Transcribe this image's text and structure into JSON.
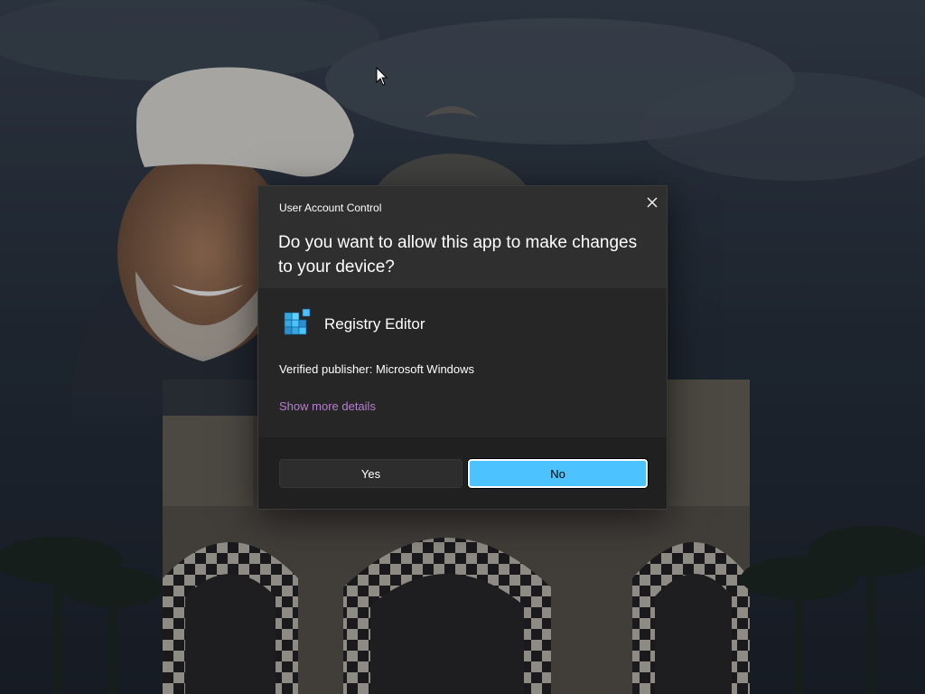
{
  "dialog": {
    "title": "User Account Control",
    "question": "Do you want to allow this app to make changes to your device?",
    "close_icon": "close-icon",
    "app": {
      "name": "Registry Editor",
      "icon": "registry-editor-icon"
    },
    "publisher": "Verified publisher: Microsoft Windows",
    "more_details": "Show more details",
    "yes_label": "Yes",
    "no_label": "No"
  },
  "colors": {
    "dialog_bg": "#2b2b2b",
    "header_bg": "#2f2f2f",
    "footer_bg": "#202020",
    "accent": "#4cc2ff",
    "link": "#b77fd1"
  }
}
